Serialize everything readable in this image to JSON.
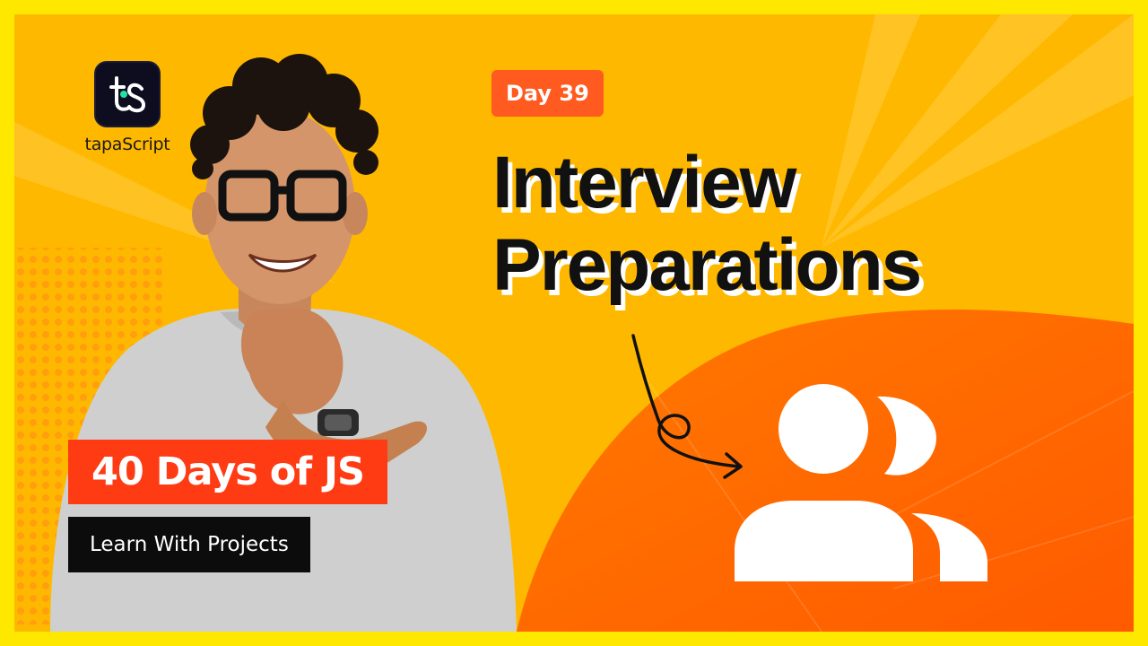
{
  "brand": {
    "name": "tapaScript",
    "logo_icon": "ts-logo-icon"
  },
  "badge": {
    "day_label": "Day 39"
  },
  "headline": {
    "line1": "Interview",
    "line2": "Preparations"
  },
  "series": {
    "title": "40 Days of JS",
    "subtitle": "Learn With Projects"
  },
  "icons": {
    "arrow": "curly-arrow-icon",
    "users": "users-group-icon"
  },
  "colors": {
    "frame": "#ffe800",
    "background": "#ffb800",
    "burst": "#ff6a00",
    "accent": "#ff5a1f",
    "series_title_bg": "#ff3b14",
    "series_subtitle_bg": "#0c0c0c",
    "text_dark": "#111111"
  }
}
